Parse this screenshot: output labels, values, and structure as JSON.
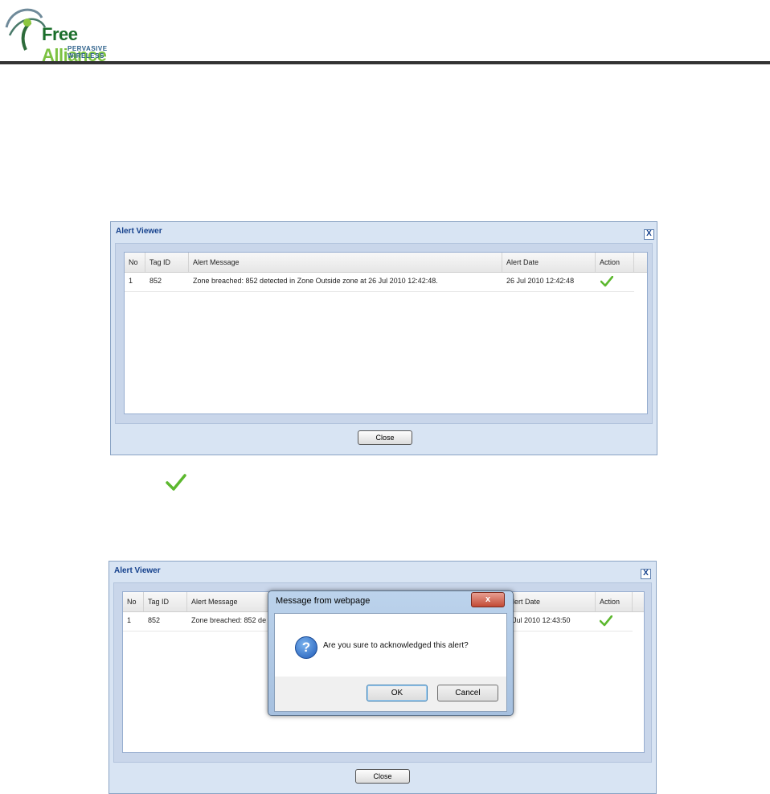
{
  "logo": {
    "name_part1": "Free",
    "name_part2": "Alliance",
    "tagline": "PERVASIVE WIRELESS"
  },
  "viewer1": {
    "title": "Alert Viewer",
    "close_x": "X",
    "columns": [
      "No",
      "Tag ID",
      "Alert Message",
      "Alert Date",
      "Action"
    ],
    "row": {
      "no": "1",
      "tag_id": "852",
      "message": "Zone breached: 852 detected in Zone Outside zone at 26 Jul 2010 12:42:48.",
      "date": "26 Jul 2010 12:42:48"
    },
    "close_button": "Close"
  },
  "viewer2": {
    "title": "Alert Viewer",
    "close_x": "X",
    "columns": [
      "No",
      "Tag ID",
      "Alert Message",
      "lert Date",
      "Action"
    ],
    "row": {
      "no": "1",
      "tag_id": "852",
      "message": "Zone breached: 852 de",
      "date": "Jul 2010 12:43:50"
    },
    "close_button": "Close"
  },
  "dialog": {
    "title": "Message from webpage",
    "close_x": "x",
    "message": "Are you sure to acknowledged this alert?",
    "icon": "question-icon",
    "ok_label": "OK",
    "cancel_label": "Cancel"
  },
  "colors": {
    "accent": "#14408c",
    "check": "#5cb82e"
  }
}
